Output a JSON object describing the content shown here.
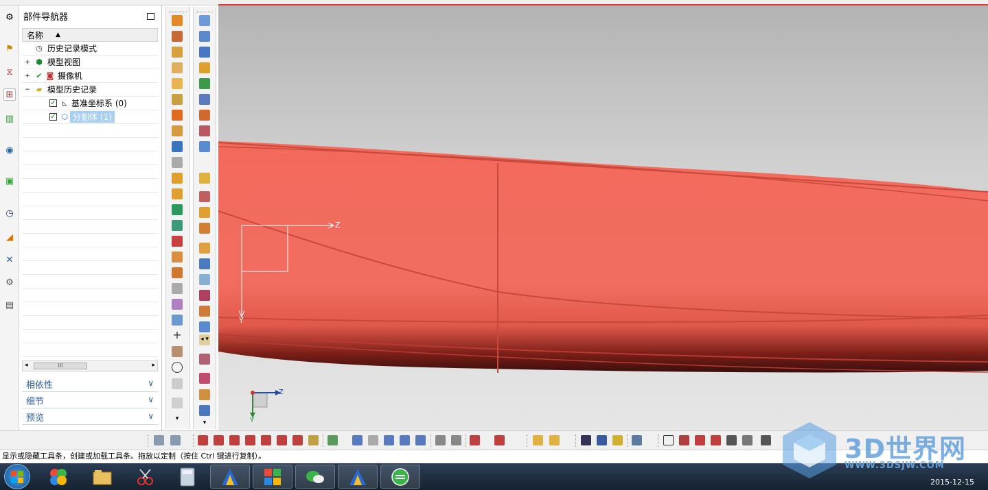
{
  "navigator": {
    "title": "部件导航器",
    "column_name": "名称",
    "items": [
      {
        "label": "历史记录模式"
      },
      {
        "label": "模型视图"
      },
      {
        "label": "摄像机"
      },
      {
        "label": "模型历史记录"
      },
      {
        "label": "基准坐标系 (0)"
      },
      {
        "label": "分割体 (1)"
      }
    ],
    "scroll_thumb": "III",
    "sections": [
      {
        "label": "相依性"
      },
      {
        "label": "细节"
      },
      {
        "label": "预览"
      }
    ]
  },
  "viewport": {
    "axis_z": "Z",
    "axis_y": "Y",
    "triad_z": "Z",
    "triad_y": "Y",
    "body_color": "#f0665a",
    "bg_top": "#b3b3b3",
    "bg_bottom": "#e6e6e6"
  },
  "status_bar": {
    "text": "显示或隐藏工具条，创建或加载工具条。拖放以定制（按住 Ctrl 键进行复制）。"
  },
  "taskbar": {
    "date": "2015-12-15"
  },
  "watermark": {
    "title": "3D世界网",
    "url": "WWW.3DSJW.COM"
  }
}
